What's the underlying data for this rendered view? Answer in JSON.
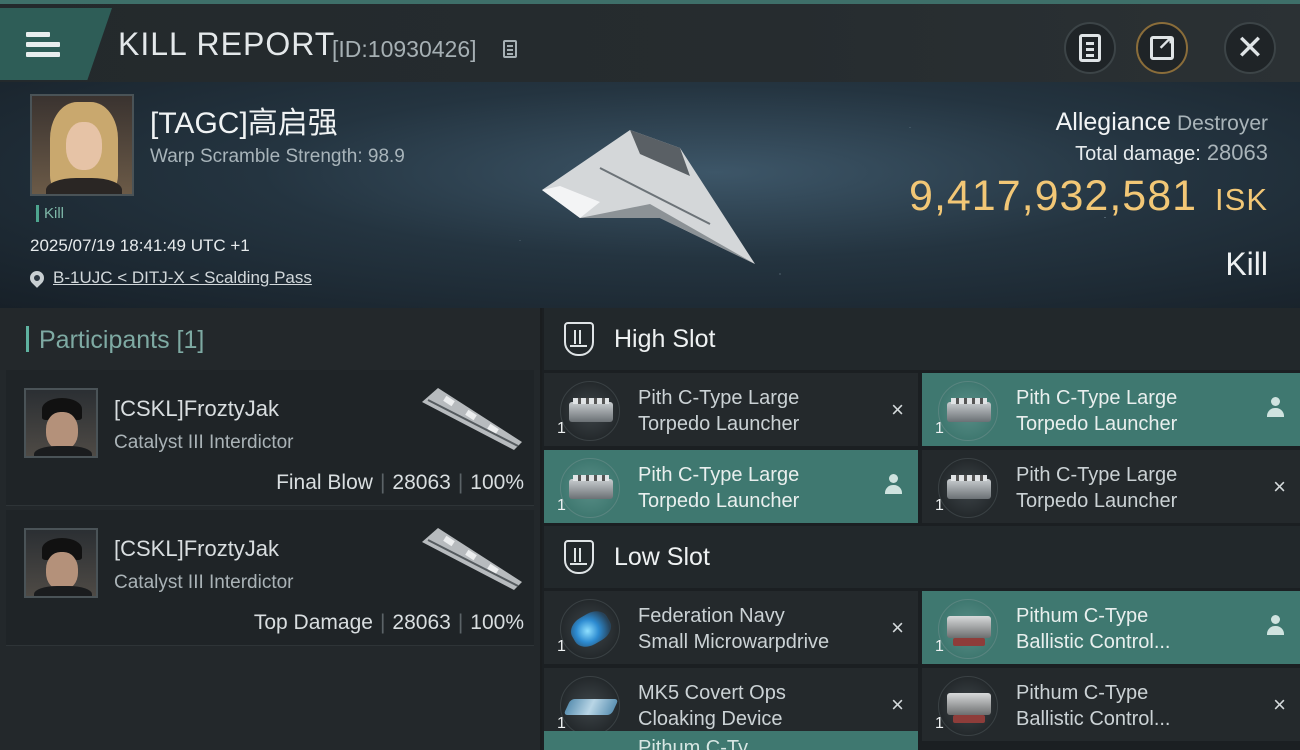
{
  "header": {
    "title": "KILL REPORT",
    "report_id": "[ID:10930426]"
  },
  "victim": {
    "name": "[TAGC]高启强",
    "warp_scramble": "Warp Scramble Strength: 98.9",
    "kill_tag": "Kill",
    "timestamp": "2025/07/19 18:41:49 UTC +1",
    "location": "B-1UJC < DITJ-X < Scalding Pass",
    "ship_name": "Allegiance",
    "ship_class": "Destroyer",
    "total_damage_label": "Total damage:",
    "total_damage": "28063",
    "isk_value": "9,417,932,581",
    "isk_unit": "ISK",
    "result": "Kill"
  },
  "participants": {
    "header": "Participants [1]",
    "rows": [
      {
        "name": "[CSKL]FroztyJak",
        "ship": "Catalyst III Interdictor",
        "role": "Final Blow",
        "damage": "28063",
        "percent": "100%"
      },
      {
        "name": "[CSKL]FroztyJak",
        "ship": "Catalyst III Interdictor",
        "role": "Top Damage",
        "damage": "28063",
        "percent": "100%"
      }
    ]
  },
  "fitting": {
    "high_slot": {
      "title": "High Slot",
      "modules": [
        {
          "line1": "Pith C-Type Large",
          "line2": "Torpedo Launcher",
          "qty": "1",
          "status": "×",
          "highlight": false,
          "pic": "launcher"
        },
        {
          "line1": "Pith C-Type Large",
          "line2": "Torpedo Launcher",
          "qty": "1",
          "status": "person",
          "highlight": true,
          "pic": "launcher"
        },
        {
          "line1": "Pith C-Type Large",
          "line2": "Torpedo Launcher",
          "qty": "1",
          "status": "person",
          "highlight": true,
          "pic": "launcher"
        },
        {
          "line1": "Pith C-Type Large",
          "line2": "Torpedo Launcher",
          "qty": "1",
          "status": "×",
          "highlight": false,
          "pic": "launcher"
        }
      ]
    },
    "low_slot": {
      "title": "Low Slot",
      "modules": [
        {
          "line1": "Federation Navy",
          "line2": "Small Microwarpdrive",
          "qty": "1",
          "status": "×",
          "highlight": false,
          "pic": "mwd"
        },
        {
          "line1": "Pithum C-Type",
          "line2": "Ballistic Control...",
          "qty": "1",
          "status": "person",
          "highlight": true,
          "pic": "ballistic"
        },
        {
          "line1": "MK5 Covert Ops",
          "line2": "Cloaking Device",
          "qty": "1",
          "status": "×",
          "highlight": false,
          "pic": "cloak"
        },
        {
          "line1": "Pithum C-Type",
          "line2": "Ballistic Control...",
          "qty": "1",
          "status": "×",
          "highlight": false,
          "pic": "ballistic"
        }
      ]
    },
    "partial_label": "Pithum C-Ty"
  },
  "icons": {
    "menu": "hamburger-menu-icon",
    "copy": "copy-icon",
    "clipboard": "clipboard-icon",
    "share": "share-icon",
    "close": "close-icon",
    "pin": "location-pin-icon",
    "slot": "slot-shield-icon",
    "pilot": "person-icon",
    "destroyed": "close-x-icon"
  },
  "colors": {
    "accent": "#3f7870",
    "isk": "#f2c776",
    "menu": "#2e5d57"
  }
}
